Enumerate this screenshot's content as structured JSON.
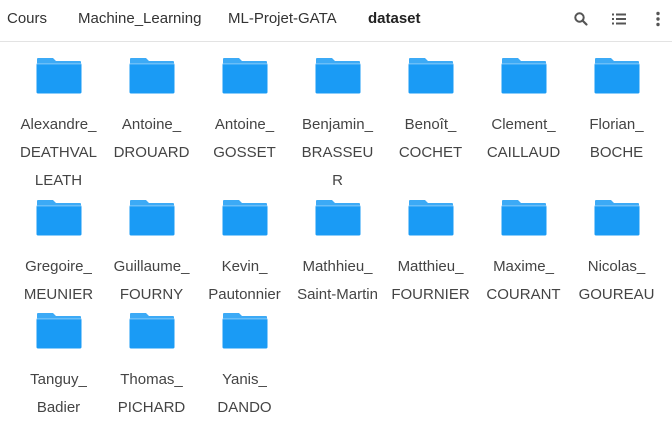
{
  "breadcrumb": [
    "Cours",
    "Machine_Learning",
    "ML-Projet-GATA",
    "dataset"
  ],
  "toolbar": {
    "search_icon": "search-icon",
    "list_icon": "list-view-icon",
    "more_icon": "more-vertical-icon"
  },
  "folder_color": "#1a9bf5",
  "folders": [
    {
      "line1": "Alexandre_",
      "line2": "DEATHVAL",
      "line3": "LEATH"
    },
    {
      "line1": "Antoine_",
      "line2": "DROUARD"
    },
    {
      "line1": "Antoine_",
      "line2": "GOSSET"
    },
    {
      "line1": "Benjamin_",
      "line2": "BRASSEU",
      "line3": "R"
    },
    {
      "line1": "Benoît_",
      "line2": "COCHET"
    },
    {
      "line1": "Clement_",
      "line2": "CAILLAUD"
    },
    {
      "line1": "Florian_",
      "line2": "BOCHE"
    },
    {
      "line1": "Gregoire_",
      "line2": "MEUNIER"
    },
    {
      "line1": "Guillaume_",
      "line2": "FOURNY"
    },
    {
      "line1": "Kevin_",
      "line2": "Pautonnier"
    },
    {
      "line1": "Mathhieu_",
      "line2": "Saint-Martin"
    },
    {
      "line1": "Matthieu_",
      "line2": "FOURNIER"
    },
    {
      "line1": "Maxime_",
      "line2": "COURANT"
    },
    {
      "line1": "Nicolas_",
      "line2": "GOUREAU"
    },
    {
      "line1": "Tanguy_",
      "line2": "Badier"
    },
    {
      "line1": "Thomas_",
      "line2": "PICHARD"
    },
    {
      "line1": "Yanis_",
      "line2": "DANDO"
    }
  ]
}
